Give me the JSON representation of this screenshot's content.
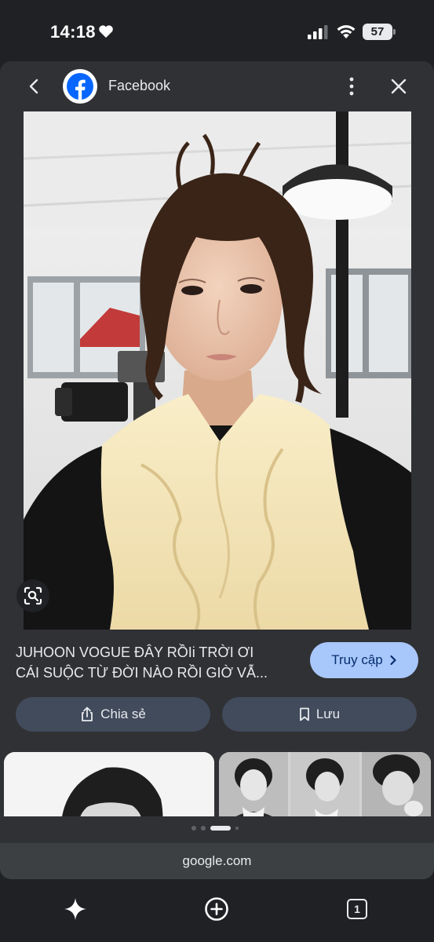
{
  "status": {
    "time": "14:18",
    "battery": "57"
  },
  "header": {
    "title": "Facebook"
  },
  "result": {
    "caption_line1": "JUHOON VOGUE ĐÂY RỒIi TRỜI ƠI",
    "caption_line2": "CÁI SUỘC TỪ ĐỜI NÀO RỒI GIỜ VẪ...",
    "visit_label": "Truy cập",
    "share_label": "Chia sẻ",
    "save_label": "Lưu"
  },
  "carousel": {
    "pages": 4,
    "active_page": 2
  },
  "url": "google.com",
  "toolbar": {
    "tab_count": "1"
  },
  "colors": {
    "background": "#202124",
    "panel": "#303134",
    "accent": "#a8c7fa",
    "pill": "#414b5c"
  }
}
